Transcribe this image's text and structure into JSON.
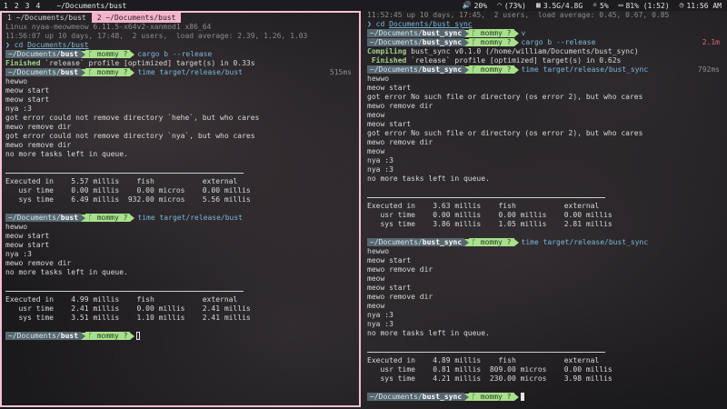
{
  "topbar": {
    "workspaces": [
      "1",
      "2",
      "3",
      "4"
    ],
    "window_title": "~/Documents/bust",
    "volume": "20%",
    "wifi": "(73%)",
    "memory": "3.5G/4.8G",
    "brightness": "5%",
    "battery": "81% (1:52)",
    "clock": "11:56 AM"
  },
  "left": {
    "tabs": [
      "1 ~/Documents/bust",
      "2 ~/Documents/bust"
    ],
    "lines": [
      {
        "t": "dim",
        "v": "Linux nyaa-meowmeow 6.11.5-x64v2-xanmod1 x86_64"
      },
      {
        "t": "dim",
        "v": "11:56:07 up 10 days, 17:48,  2 users,  load average: 2.39, 1.26, 1.03"
      },
      {
        "t": "cd",
        "pre": "❯ ",
        "cmd": "cd ",
        "arg": "Documents/bust"
      },
      {
        "t": "prompt",
        "dir": "~/Documents/",
        "dirb": "bust",
        "git": "mommy ?",
        "cmd": "cargo b --release"
      },
      {
        "t": "finished",
        "label": "Finished",
        "rest": " `release` profile [optimized] target(s) in 0.33s"
      },
      {
        "t": "prompt",
        "dir": "~/Documents/",
        "dirb": "bust",
        "git": "mommy ?",
        "cmd": "time target/release/bust",
        "right": "515ms"
      },
      {
        "t": "plain",
        "v": "hewwo"
      },
      {
        "t": "plain",
        "v": "meow start"
      },
      {
        "t": "plain",
        "v": "meow start"
      },
      {
        "t": "plain",
        "v": "nya :3"
      },
      {
        "t": "plain",
        "v": "got error could not remove directory `hehe`, but who cares"
      },
      {
        "t": "plain",
        "v": "mewo remove dir"
      },
      {
        "t": "plain",
        "v": "got error could not remove directory `nya`, but who cares"
      },
      {
        "t": "plain",
        "v": "mewo remove dir"
      },
      {
        "t": "plain",
        "v": "no more tasks left in queue."
      },
      {
        "t": "plain",
        "v": ""
      },
      {
        "t": "rule"
      },
      {
        "t": "plain",
        "v": "Executed in    5.57 millis    fish           external"
      },
      {
        "t": "plain",
        "v": "   usr time    0.00 millis    0.00 micros    0.00 millis"
      },
      {
        "t": "plain",
        "v": "   sys time    6.49 millis  932.00 micros    5.56 millis"
      },
      {
        "t": "plain",
        "v": ""
      },
      {
        "t": "prompt",
        "dir": "~/Documents/",
        "dirb": "bust",
        "git": "mommy ?",
        "cmd": "time target/release/bust"
      },
      {
        "t": "plain",
        "v": "hewwo"
      },
      {
        "t": "plain",
        "v": "meow start"
      },
      {
        "t": "plain",
        "v": "meow start"
      },
      {
        "t": "plain",
        "v": "nya :3"
      },
      {
        "t": "plain",
        "v": "mewo remove dir"
      },
      {
        "t": "plain",
        "v": "no more tasks left in queue."
      },
      {
        "t": "plain",
        "v": ""
      },
      {
        "t": "rule"
      },
      {
        "t": "plain",
        "v": "Executed in    4.99 millis    fish           external"
      },
      {
        "t": "plain",
        "v": "   usr time    2.41 millis    0.00 millis    2.41 millis"
      },
      {
        "t": "plain",
        "v": "   sys time    3.51 millis    1.10 millis    2.41 millis"
      },
      {
        "t": "plain",
        "v": ""
      },
      {
        "t": "prompt",
        "dir": "~/Documents/",
        "dirb": "bust",
        "git": "mommy ?",
        "cmd": "",
        "cursor": "outline"
      }
    ]
  },
  "right": {
    "lines": [
      {
        "t": "dim",
        "v": "11:52:45 up 10 days, 17:45,  2 users,  load average: 0.45, 0.67, 0.85"
      },
      {
        "t": "cd",
        "pre": "❯ ",
        "cmd": "cd ",
        "arg": "Documents/bust_sync"
      },
      {
        "t": "prompt",
        "dir": "~/Documents/",
        "dirb": "bust_sync",
        "git": "mommy ?",
        "cmd": "v"
      },
      {
        "t": "prompt",
        "dir": "~/Documents/",
        "dirb": "bust_sync",
        "git": "mommy ?",
        "cmd": "cargo b --release",
        "right": "2.1m",
        "rightRed": true
      },
      {
        "t": "finished",
        "label": "Compiling",
        "rest": " bust_sync v0.1.0 (/home/william/Documents/bust_sync)"
      },
      {
        "t": "finished",
        "label": " Finished",
        "rest": " `release` profile [optimized] target(s) in 0.62s"
      },
      {
        "t": "prompt",
        "dir": "~/Documents/",
        "dirb": "bust_sync",
        "git": "mommy ?",
        "cmd": "time target/release/bust_sync",
        "right": "792ms"
      },
      {
        "t": "plain",
        "v": "hewwo"
      },
      {
        "t": "plain",
        "v": "meow start"
      },
      {
        "t": "plain",
        "v": "got error No such file or directory (os error 2), but who cares"
      },
      {
        "t": "plain",
        "v": "mewo remove dir"
      },
      {
        "t": "plain",
        "v": "meow"
      },
      {
        "t": "plain",
        "v": "meow start"
      },
      {
        "t": "plain",
        "v": "got error No such file or directory (os error 2), but who cares"
      },
      {
        "t": "plain",
        "v": "mewo remove dir"
      },
      {
        "t": "plain",
        "v": "meow"
      },
      {
        "t": "plain",
        "v": "nya :3"
      },
      {
        "t": "plain",
        "v": "nya :3"
      },
      {
        "t": "plain",
        "v": "no more tasks left in queue."
      },
      {
        "t": "plain",
        "v": ""
      },
      {
        "t": "rule"
      },
      {
        "t": "plain",
        "v": "Executed in    3.63 millis    fish           external"
      },
      {
        "t": "plain",
        "v": "   usr time    0.00 millis    0.00 millis    0.00 millis"
      },
      {
        "t": "plain",
        "v": "   sys time    3.86 millis    1.05 millis    2.81 millis"
      },
      {
        "t": "plain",
        "v": ""
      },
      {
        "t": "prompt",
        "dir": "~/Documents/",
        "dirb": "bust_sync",
        "git": "mommy ?",
        "cmd": "time target/release/bust_sync"
      },
      {
        "t": "plain",
        "v": "hewwo"
      },
      {
        "t": "plain",
        "v": "meow start"
      },
      {
        "t": "plain",
        "v": "mewo remove dir"
      },
      {
        "t": "plain",
        "v": "meow"
      },
      {
        "t": "plain",
        "v": "meow start"
      },
      {
        "t": "plain",
        "v": "mewo remove dir"
      },
      {
        "t": "plain",
        "v": "meow"
      },
      {
        "t": "plain",
        "v": "nya :3"
      },
      {
        "t": "plain",
        "v": "nya :3"
      },
      {
        "t": "plain",
        "v": "no more tasks left in queue."
      },
      {
        "t": "plain",
        "v": ""
      },
      {
        "t": "rule"
      },
      {
        "t": "plain",
        "v": "Executed in    4.89 millis    fish           external"
      },
      {
        "t": "plain",
        "v": "   usr time    0.81 millis  809.00 micros    0.00 millis"
      },
      {
        "t": "plain",
        "v": "   sys time    4.21 millis  230.00 micros    3.98 millis"
      },
      {
        "t": "plain",
        "v": ""
      },
      {
        "t": "prompt",
        "dir": "~/Documents/",
        "dirb": "bust_sync",
        "git": "mommy ?",
        "cmd": "",
        "cursor": "filled"
      }
    ]
  }
}
